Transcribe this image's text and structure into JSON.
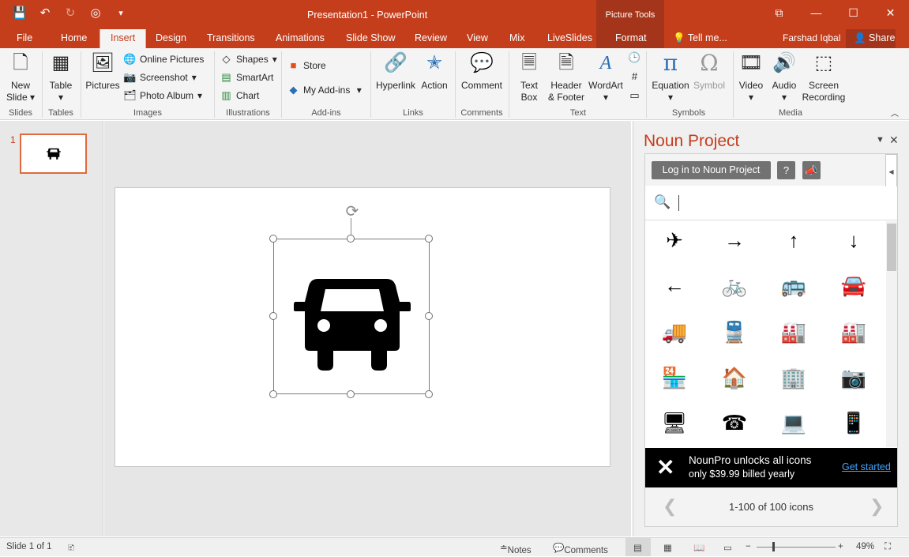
{
  "window": {
    "title": "Presentation1 - PowerPoint",
    "context_header": "Picture Tools",
    "minimize_glyph": "—",
    "restore_glyph": "☐",
    "close_glyph": "✕",
    "ribbon_display_glyph": "⧉"
  },
  "qat": {
    "save": "💾",
    "undo": "↶",
    "redo": "↻",
    "present": "◎",
    "customize": "▾"
  },
  "tabs": [
    "File",
    "Home",
    "Insert",
    "Design",
    "Transitions",
    "Animations",
    "Slide Show",
    "Review",
    "View",
    "Mix",
    "LiveSlides",
    "Format",
    "Tell me..."
  ],
  "user": {
    "name": "Farshad Iqbal",
    "share": "Share"
  },
  "ribbon": {
    "new_slide": "New Slide",
    "table": "Table",
    "pictures": "Pictures",
    "online_pictures": "Online Pictures",
    "screenshot": "Screenshot",
    "photo_album": "Photo Album",
    "shapes": "Shapes",
    "smartart": "SmartArt",
    "chart": "Chart",
    "store": "Store",
    "my_addins": "My Add-ins",
    "hyperlink": "Hyperlink",
    "action": "Action",
    "comment": "Comment",
    "text_box": "Text Box",
    "header_footer": "Header & Footer",
    "wordart": "WordArt",
    "equation": "Equation",
    "symbol": "Symbol",
    "video": "Video",
    "audio": "Audio",
    "screen_recording": "Screen Recording",
    "groups": [
      "Slides",
      "Tables",
      "Images",
      "Illustrations",
      "Add-ins",
      "Links",
      "Comments",
      "Text",
      "Symbols",
      "Media"
    ]
  },
  "slides": {
    "number": "1"
  },
  "pane": {
    "title": "Noun Project",
    "login": "Log in to Noun Project",
    "help_glyph": "?",
    "announce_glyph": "📣",
    "search_placeholder": "",
    "icons": [
      "✈",
      "→",
      "↑",
      "↓",
      "←",
      "🚲",
      "🚌",
      "🚘",
      "🚚",
      "🚆",
      "🏭",
      "🏭",
      "🏪",
      "🏠",
      "🏢",
      "📷",
      "🖥",
      "☎",
      "💻",
      "📱"
    ],
    "promo_line1": "NounPro unlocks all icons",
    "promo_line2": "only $39.99 billed yearly",
    "promo_cta": "Get started",
    "pager": "1-100 of 100 icons",
    "prev_glyph": "❮",
    "next_glyph": "❯"
  },
  "status": {
    "slide": "Slide 1 of 1",
    "notes": "Notes",
    "comments": "Comments",
    "zoom": "49%"
  }
}
